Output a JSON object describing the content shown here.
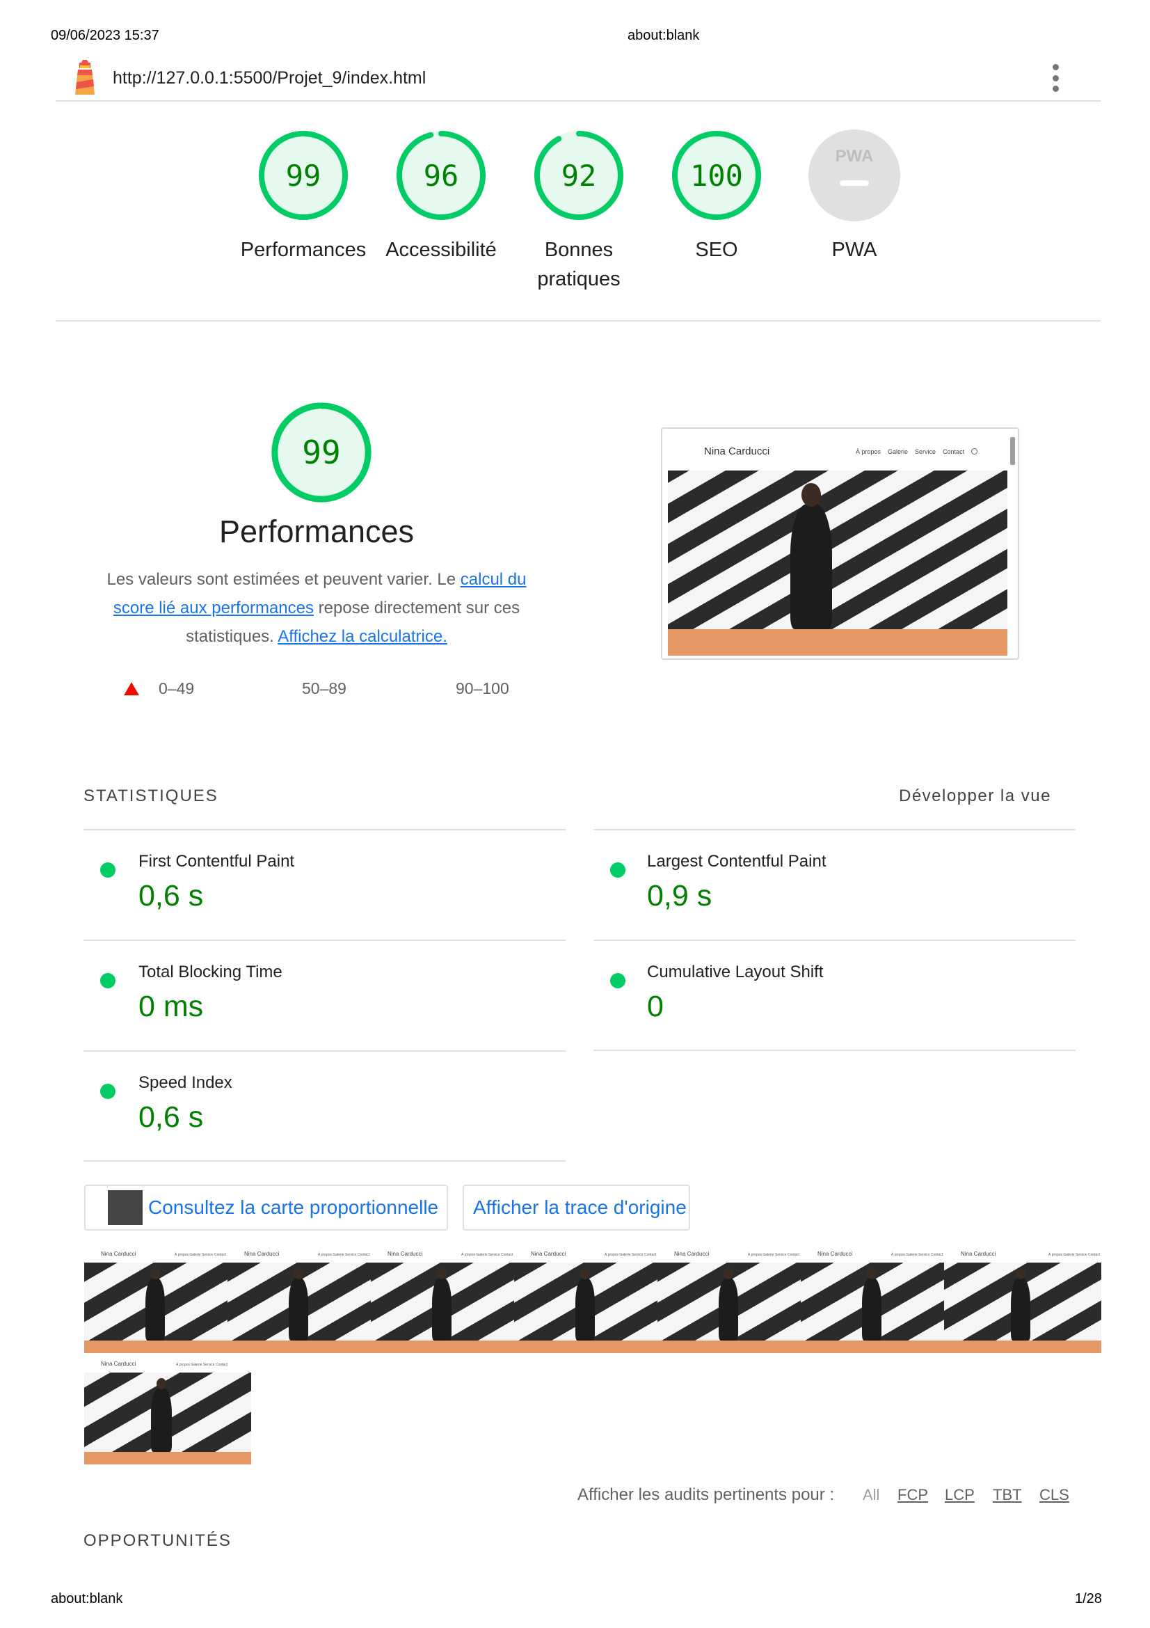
{
  "print_header": {
    "datetime": "09/06/2023 15:37",
    "title": "about:blank"
  },
  "print_footer": {
    "left": "about:blank",
    "page": "1/28"
  },
  "topbar": {
    "url": "http://127.0.0.1:5500/Projet_9/index.html"
  },
  "gauges": [
    {
      "score": "99",
      "label": "Performances",
      "value": 99
    },
    {
      "score": "96",
      "label": "Accessibilité",
      "value": 96
    },
    {
      "score": "92",
      "label_line1": "Bonnes",
      "label_line2": "pratiques",
      "value": 92
    },
    {
      "score": "100",
      "label": "SEO",
      "value": 100
    },
    {
      "label": "PWA",
      "badge": "PWA"
    }
  ],
  "performance": {
    "score": "99",
    "score_value": 99,
    "title": "Performances",
    "desc_1": "Les valeurs sont estimées et peuvent varier. Le ",
    "link_1": "calcul du score lié aux performances",
    "desc_2": " repose directement sur ces statistiques. ",
    "link_2": "Affichez la calculatrice.",
    "legend": [
      "0–49",
      "50–89",
      "90–100"
    ]
  },
  "preview": {
    "site_name": "Nina Carducci",
    "nav": [
      "À propos",
      "Galerie",
      "Service",
      "Contact"
    ]
  },
  "stats": {
    "heading": "STATISTIQUES",
    "toggle": "Développer la vue",
    "metrics": [
      {
        "title": "First Contentful Paint",
        "value": "0,6 s"
      },
      {
        "title": "Largest Contentful Paint",
        "value": "0,9 s"
      },
      {
        "title": "Total Blocking Time",
        "value": "0 ms"
      },
      {
        "title": "Cumulative Layout Shift",
        "value": "0"
      },
      {
        "title": "Speed Index",
        "value": "0,6 s"
      }
    ]
  },
  "buttons": {
    "treemap": "Consultez la carte proportionnelle",
    "trace": "Afficher la trace d'origine"
  },
  "filmstrip": {
    "site_name": "Nina Carducci",
    "nav": "À propos  Galerie  Service  Contact"
  },
  "audit_filter": {
    "label": "Afficher les audits pertinents pour :",
    "options": [
      "All",
      "FCP",
      "LCP",
      "TBT",
      "CLS"
    ]
  },
  "opportunities": {
    "heading": "OPPORTUNITÉS"
  },
  "colors": {
    "pass": "#0c6",
    "pass_text": "#008000",
    "pass_bg": "#e5f9ee",
    "average": "#fa3",
    "fail": "#eb0f00",
    "link": "#1a73e8"
  }
}
